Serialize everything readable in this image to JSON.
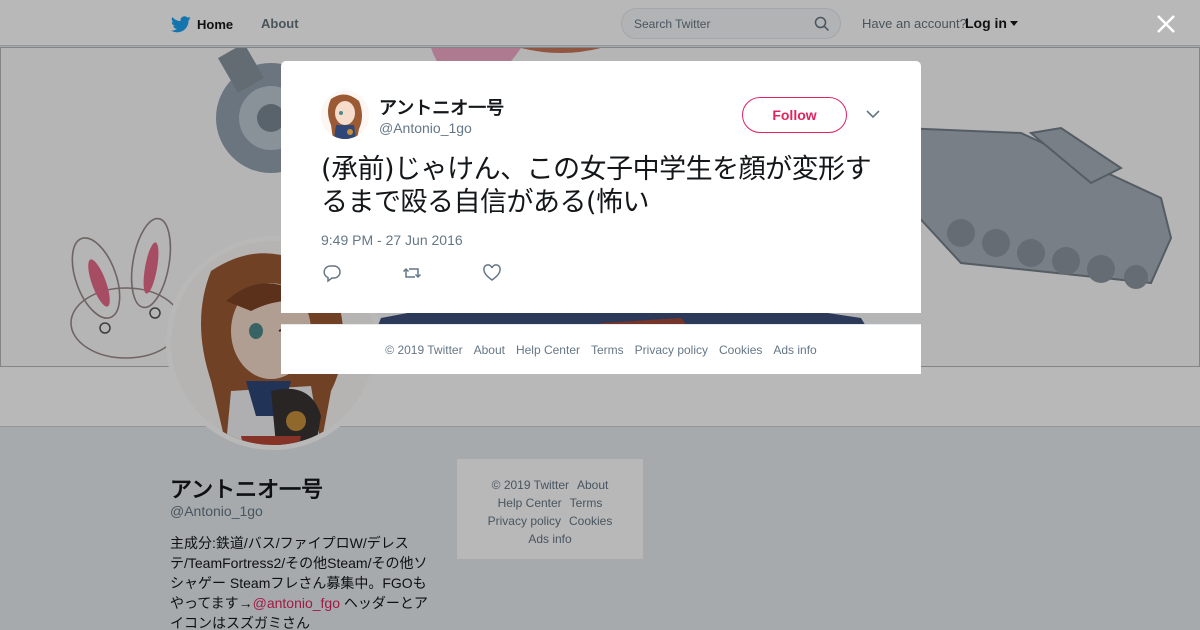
{
  "nav": {
    "home_label": "Home",
    "about_label": "About",
    "search_placeholder": "Search Twitter",
    "have_account": "Have an account?",
    "login_label": "Log in"
  },
  "profile": {
    "name": "アントニオ一号",
    "handle": "@Antonio_1go",
    "bio_text": "主成分:鉄道/バス/ファイプロW/デレステ/TeamFortress2/その他Steam/その他ソシャゲー Steamフレさん募集中。FGOもやってます→",
    "bio_link": "@antonio_fgo",
    "bio_after": " ヘッダーとアイコンはスズガミさん"
  },
  "sidebar_footer": {
    "copyright": "© 2019 Twitter",
    "about": "About",
    "help": "Help Center",
    "terms": "Terms",
    "privacy": "Privacy policy",
    "cookies": "Cookies",
    "ads": "Ads info"
  },
  "tweet": {
    "name": "アントニオ一号",
    "handle": "@Antonio_1go",
    "follow_label": "Follow",
    "text": "(承前)じゃけん、この女子中学生を顔が変形するまで殴る自信がある(怖い",
    "timestamp": "9:49 PM - 27 Jun 2016"
  },
  "modal_footer": {
    "copyright": "© 2019 Twitter",
    "about": "About",
    "help": "Help Center",
    "terms": "Terms",
    "privacy": "Privacy policy",
    "cookies": "Cookies",
    "ads": "Ads info"
  },
  "colors": {
    "accent": "#e0245e",
    "twitter_blue": "#1da1f2",
    "secondary_text": "#657786"
  },
  "icons": [
    "twitter-bird-icon",
    "search-icon",
    "caret-down-icon",
    "close-icon",
    "chevron-down-icon",
    "reply-icon",
    "retweet-icon",
    "like-icon"
  ]
}
